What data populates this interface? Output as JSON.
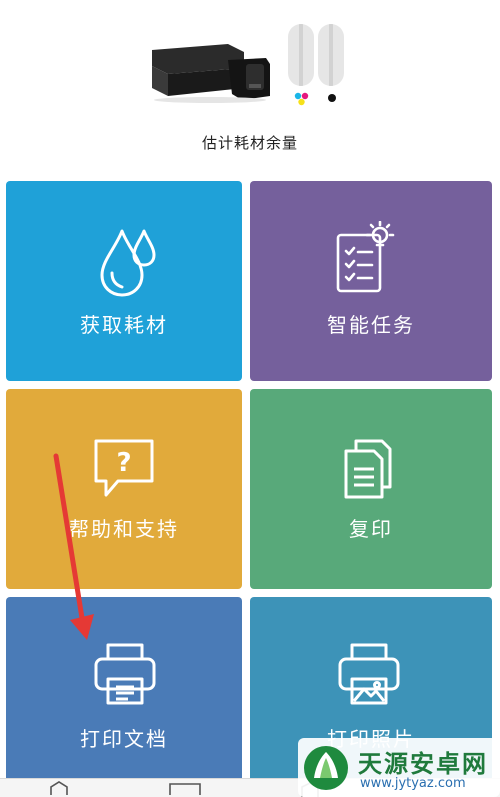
{
  "header": {
    "ink_label": "估计耗材余量"
  },
  "tiles": [
    {
      "label": "获取耗材",
      "color": "#1fa1d8",
      "icon": "ink-drops-icon"
    },
    {
      "label": "智能任务",
      "color": "#75609c",
      "icon": "smart-task-icon"
    },
    {
      "label": "帮助和支持",
      "color": "#e1aa3b",
      "icon": "help-icon"
    },
    {
      "label": "复印",
      "color": "#58a97a",
      "icon": "copy-icon"
    },
    {
      "label": "打印文档",
      "color": "#4a7bb7",
      "icon": "print-document-icon"
    },
    {
      "label": "打印照片",
      "color": "#3d93b8",
      "icon": "print-photo-icon"
    }
  ],
  "annotation": {
    "arrow_color": "#e53935"
  },
  "watermark": {
    "title": "天源安卓网",
    "url": "www.jytyaz.com"
  }
}
